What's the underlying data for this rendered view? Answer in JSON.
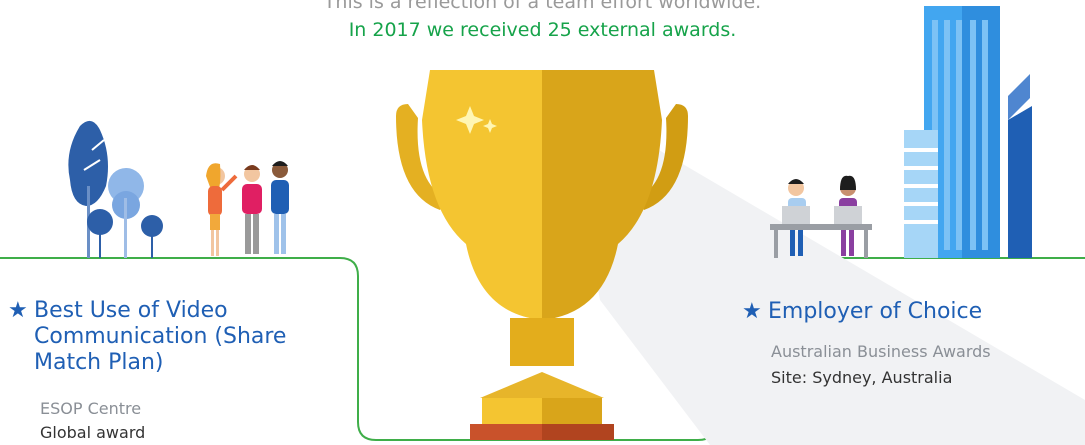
{
  "intro": {
    "line1": "This is a reflection of a team effort worldwide.",
    "line2": "In 2017 we received 25 external awards."
  },
  "awards": [
    {
      "title": "Best Use of Video Communication (Share Match Plan)",
      "organization": "ESOP Centre",
      "location": "Global award"
    },
    {
      "title": "Employer of Choice",
      "organization": "Australian Business Awards",
      "location": "Site: Sydney, Australia"
    }
  ],
  "colors": {
    "accent_blue": "#1f5fb4",
    "accent_green": "#16a34a",
    "trophy_gold": "#f2c230",
    "trophy_base": "#c9522b"
  }
}
